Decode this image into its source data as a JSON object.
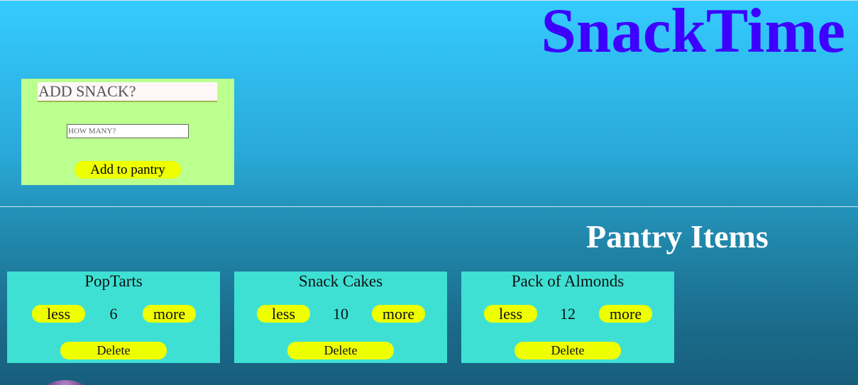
{
  "header": {
    "title": "SnackTime",
    "title_color": "#3d00ff"
  },
  "add_form": {
    "snack_placeholder": "ADD SNACK?",
    "snack_value": "",
    "quantity_placeholder": "HOW MANY?",
    "quantity_value": "",
    "submit_label": "Add to pantry",
    "panel_color": "#bbff8f",
    "button_color": "#eeff00"
  },
  "pantry": {
    "title": "Pantry Items",
    "card_color": "#3ee0d4",
    "items": [
      {
        "name": "PopTarts",
        "count": "6",
        "less_label": "less",
        "more_label": "more",
        "delete_label": "Delete"
      },
      {
        "name": "Snack Cakes",
        "count": "10",
        "less_label": "less",
        "more_label": "more",
        "delete_label": "Delete"
      },
      {
        "name": "Pack of Almonds",
        "count": "12",
        "less_label": "less",
        "more_label": "more",
        "delete_label": "Delete"
      }
    ]
  },
  "background": {
    "gradient_top": "#35cbff",
    "gradient_bottom": "#185e7c"
  }
}
